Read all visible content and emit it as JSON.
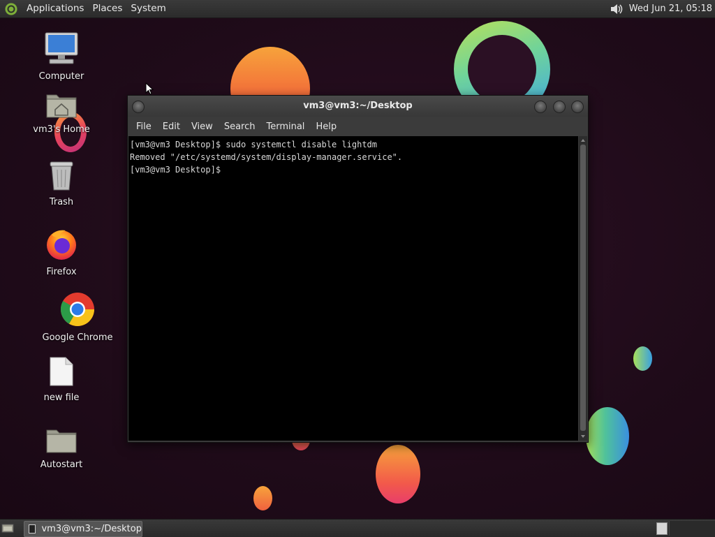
{
  "top_panel": {
    "menus": [
      "Applications",
      "Places",
      "System"
    ],
    "clock": "Wed Jun 21, 05:18",
    "volume_icon": "volume-icon"
  },
  "desktop_icons": [
    {
      "label": "Computer",
      "icon": "computer-icon"
    },
    {
      "label": "vm3's Home",
      "icon": "home-folder-icon"
    },
    {
      "label": "Trash",
      "icon": "trash-icon"
    },
    {
      "label": "Firefox",
      "icon": "firefox-icon"
    },
    {
      "label": "Google Chrome",
      "icon": "chrome-icon"
    },
    {
      "label": "new file",
      "icon": "file-icon"
    },
    {
      "label": "Autostart",
      "icon": "folder-icon"
    }
  ],
  "terminal": {
    "title": "vm3@vm3:~/Desktop",
    "menus": [
      "File",
      "Edit",
      "View",
      "Search",
      "Terminal",
      "Help"
    ],
    "lines": [
      "[vm3@vm3 Desktop]$ sudo systemctl disable lightdm",
      "Removed \"/etc/systemd/system/display-manager.service\".",
      "[vm3@vm3 Desktop]$ "
    ]
  },
  "taskbar": {
    "task_label": "vm3@vm3:~/Desktop"
  },
  "colors": {
    "panel": "#2f2f2f",
    "wallpaper": "#220d1c",
    "terminal_bg": "#000000",
    "terminal_fg": "#d8d8d8"
  }
}
